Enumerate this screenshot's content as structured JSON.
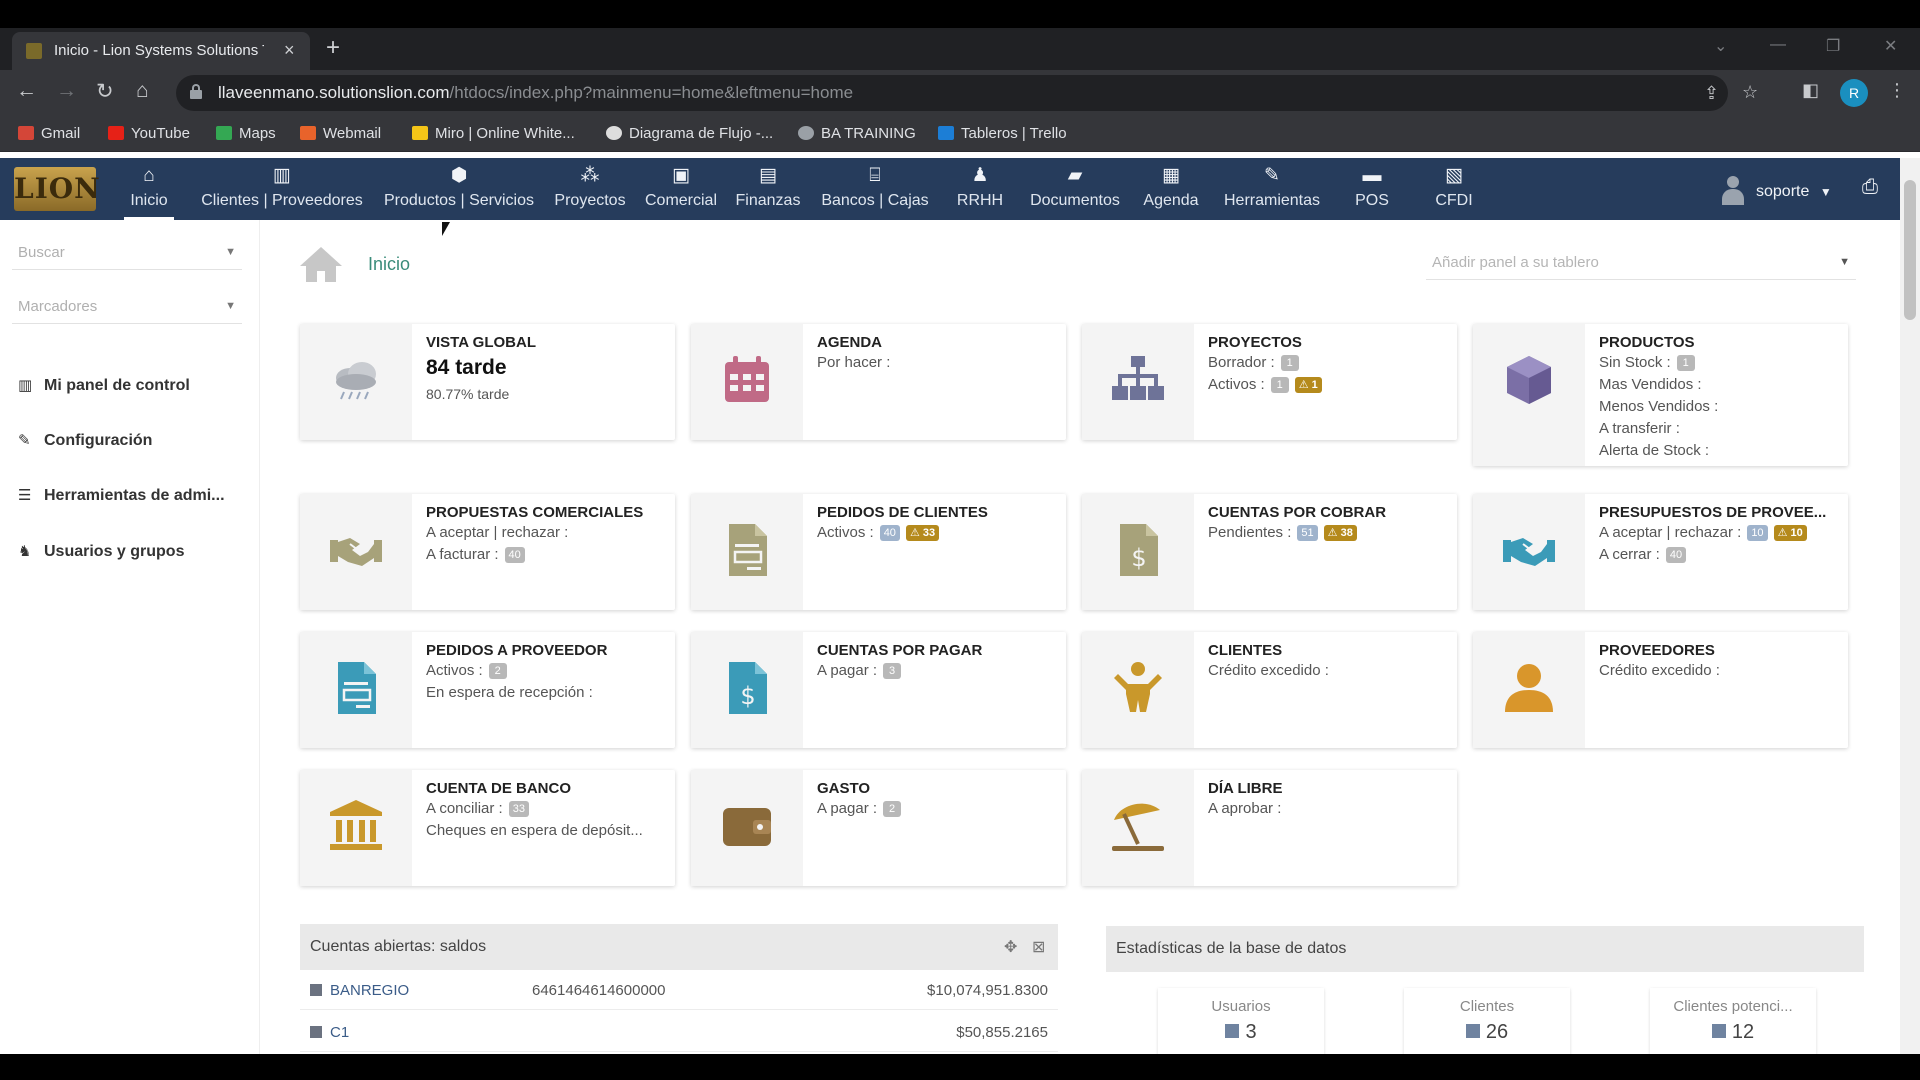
{
  "browser": {
    "tab_title": "Inicio - Lion Systems Solutions T",
    "url_host": "llaveenmano.solutionslion.com",
    "url_path": "/htdocs/index.php?mainmenu=home&leftmenu=home",
    "profile_initial": "R",
    "bookmarks": [
      {
        "label": "Gmail",
        "icon": "gmail-icon",
        "color": "#d44638"
      },
      {
        "label": "YouTube",
        "icon": "youtube-icon",
        "color": "#e62117"
      },
      {
        "label": "Maps",
        "icon": "maps-icon",
        "color": "#34a853"
      },
      {
        "label": "Webmail",
        "icon": "webmail-icon",
        "color": "#e8632b"
      },
      {
        "label": "Miro | Online White...",
        "icon": "miro-icon",
        "color": "#f5c518"
      },
      {
        "label": "Diagrama de Flujo -...",
        "icon": "diagram-icon",
        "color": "#dddddd"
      },
      {
        "label": "BA TRAINING",
        "icon": "globe-icon",
        "color": "#9aa0a6"
      },
      {
        "label": "Tableros | Trello",
        "icon": "trello-icon",
        "color": "#1c7ed6"
      }
    ]
  },
  "app": {
    "logo_text": "LION",
    "nav": [
      {
        "label": "Inicio",
        "icon": "home-icon",
        "glyph": "⌂"
      },
      {
        "label": "Clientes | Proveedores",
        "icon": "building-icon",
        "glyph": "▥"
      },
      {
        "label": "Productos | Servicios",
        "icon": "cube-icon",
        "glyph": "⬢"
      },
      {
        "label": "Proyectos",
        "icon": "sitemap-icon",
        "glyph": "⁂"
      },
      {
        "label": "Comercial",
        "icon": "briefcase-icon",
        "glyph": "▣"
      },
      {
        "label": "Finanzas",
        "icon": "money-icon",
        "glyph": "▤"
      },
      {
        "label": "Bancos | Cajas",
        "icon": "bank-icon",
        "glyph": "⌸"
      },
      {
        "label": "RRHH",
        "icon": "user-tie-icon",
        "glyph": "♟"
      },
      {
        "label": "Documentos",
        "icon": "folder-icon",
        "glyph": "▰"
      },
      {
        "label": "Agenda",
        "icon": "calendar-icon",
        "glyph": "▦"
      },
      {
        "label": "Herramientas",
        "icon": "wrench-icon",
        "glyph": "✎"
      },
      {
        "label": "POS",
        "icon": "cash-register-icon",
        "glyph": "▬"
      },
      {
        "label": "CFDI",
        "icon": "invoice-icon",
        "glyph": "▧"
      }
    ],
    "user": "soporte",
    "sidebar": {
      "search_placeholder": "Buscar",
      "bookmarks_placeholder": "Marcadores",
      "items": [
        {
          "label": "Mi panel de control",
          "icon": "chart-icon",
          "glyph": "▥"
        },
        {
          "label": "Configuración",
          "icon": "wrench-icon",
          "glyph": "✎"
        },
        {
          "label": "Herramientas de admi...",
          "icon": "list-icon",
          "glyph": "☰"
        },
        {
          "label": "Usuarios y grupos",
          "icon": "users-icon",
          "glyph": "♞"
        }
      ]
    },
    "breadcrumb": "Inicio",
    "add_panel_placeholder": "Añadir panel a su tablero",
    "cards": {
      "vista_global": {
        "title": "VISTA GLOBAL",
        "big": "84 tarde",
        "sub": "80.77% tarde"
      },
      "agenda": {
        "title": "AGENDA",
        "l1": "Por hacer :"
      },
      "proyectos": {
        "title": "PROYECTOS",
        "l1": "Borrador :",
        "b1": "1",
        "l2": "Activos :",
        "b2": "1",
        "w2": "⚠ 1"
      },
      "productos": {
        "title": "PRODUCTOS",
        "l1": "Sin Stock :",
        "b1": "1",
        "l2": "Mas Vendidos :",
        "l3": "Menos Vendidos :",
        "l4": "A transferir :",
        "l5": "Alerta de Stock :"
      },
      "propuestas": {
        "title": "PROPUESTAS COMERCIALES",
        "l1": "A aceptar | rechazar :",
        "l2": "A facturar :",
        "b2": "40"
      },
      "pedidos_clientes": {
        "title": "PEDIDOS DE CLIENTES",
        "l1": "Activos :",
        "b1": "40",
        "w1": "⚠ 33"
      },
      "cuentas_cobrar": {
        "title": "CUENTAS POR COBRAR",
        "l1": "Pendientes :",
        "b1": "51",
        "w1": "⚠ 38"
      },
      "presupuestos": {
        "title": "PRESUPUESTOS DE PROVEE...",
        "l1": "A aceptar | rechazar :",
        "b1": "10",
        "w1": "⚠ 10",
        "l2": "A cerrar :",
        "b2": "40"
      },
      "pedidos_proveedor": {
        "title": "PEDIDOS A PROVEEDOR",
        "l1": "Activos :",
        "b1": "2",
        "l2": "En espera de recepción :"
      },
      "cuentas_pagar": {
        "title": "CUENTAS POR PAGAR",
        "l1": "A pagar :",
        "b1": "3"
      },
      "clientes": {
        "title": "CLIENTES",
        "l1": "Crédito excedido :"
      },
      "proveedores": {
        "title": "PROVEEDORES",
        "l1": "Crédito excedido :"
      },
      "cuenta_banco": {
        "title": "CUENTA DE BANCO",
        "l1": "A conciliar :",
        "b1": "33",
        "l2": "Cheques en espera de depósit..."
      },
      "gasto": {
        "title": "GASTO",
        "l1": "A pagar :",
        "b1": "2"
      },
      "dia_libre": {
        "title": "DÍA LIBRE",
        "l1": "A aprobar :"
      }
    },
    "accounts_panel": {
      "title": "Cuentas abiertas: saldos",
      "rows": [
        {
          "name": "BANREGIO",
          "number": "6461464614600000",
          "amount": "$10,074,951.8300"
        },
        {
          "name": "C1",
          "number": "",
          "amount": "$50,855.2165"
        }
      ]
    },
    "stats_panel": {
      "title": "Estadísticas de la base de datos",
      "items": [
        {
          "label": "Usuarios",
          "value": "3",
          "icon": "user-icon"
        },
        {
          "label": "Clientes",
          "value": "26",
          "icon": "building-icon"
        },
        {
          "label": "Clientes potenci...",
          "value": "12",
          "icon": "building-icon"
        }
      ]
    },
    "colors": {
      "nav_bg": "#263c5c",
      "accent_green": "#3a8c7a",
      "warning": "#b58a1c",
      "icon_purple": "#7b6fa6",
      "icon_teal": "#3b9bb8",
      "icon_olive": "#a7a27a",
      "icon_gold": "#c9982b",
      "icon_brown": "#8a6a3a"
    }
  }
}
